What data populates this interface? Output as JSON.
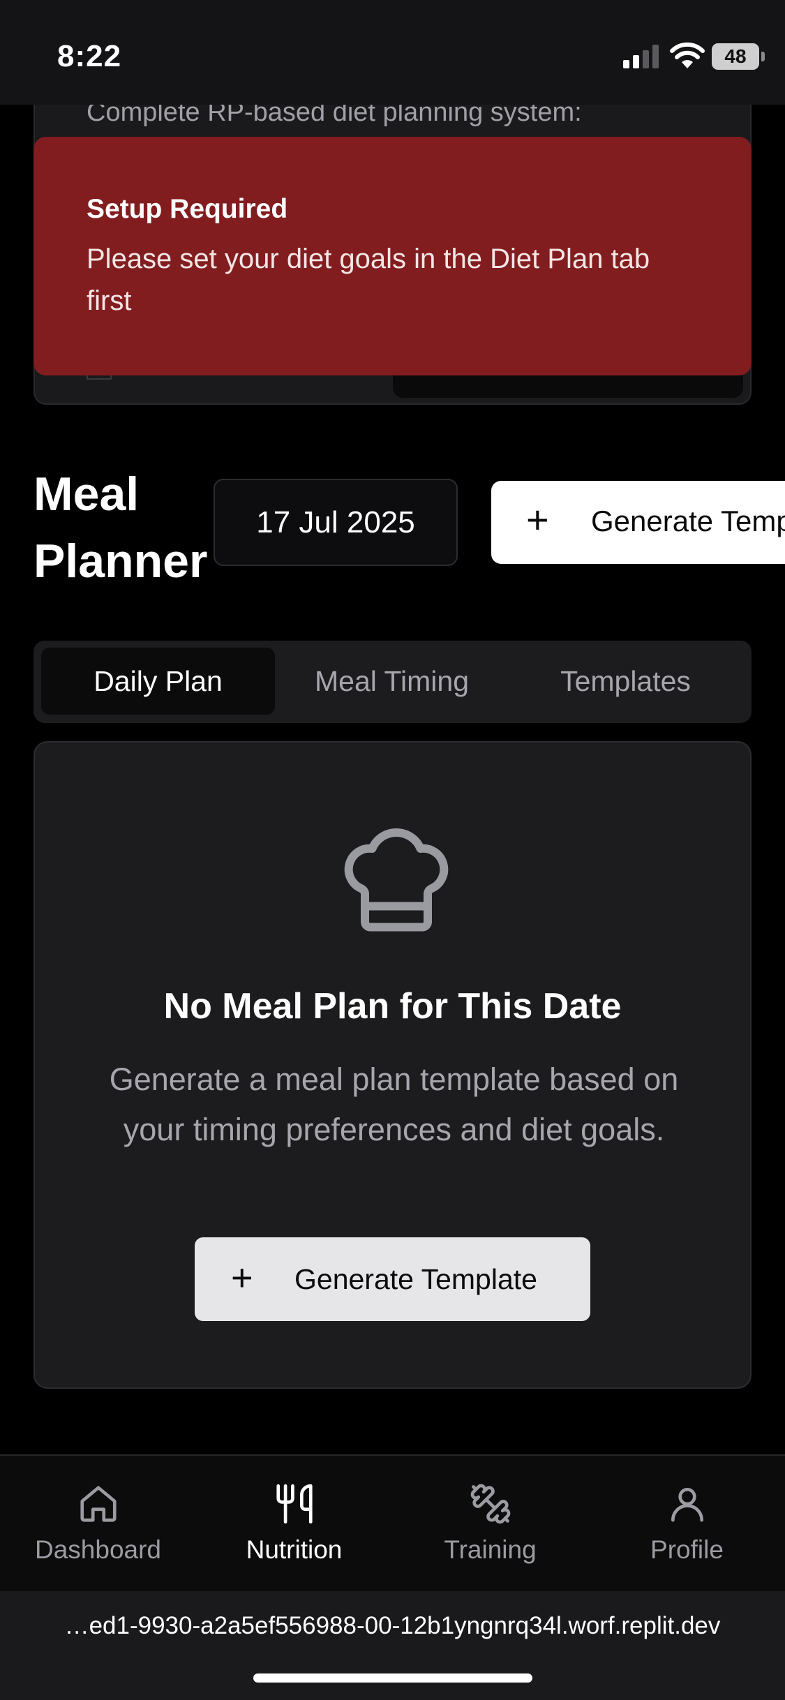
{
  "status_bar": {
    "time": "8:22",
    "battery": "48"
  },
  "background_card": {
    "text": "Complete RP-based diet planning system:"
  },
  "toast": {
    "title": "Setup Required",
    "message": "Please set your diet goals in the Diet Plan tab first"
  },
  "header": {
    "title": "Meal Planner",
    "date": "17 Jul 2025",
    "generate_label": "Generate Template"
  },
  "tabs": [
    {
      "label": "Daily Plan",
      "active": true
    },
    {
      "label": "Meal Timing",
      "active": false
    },
    {
      "label": "Templates",
      "active": false
    }
  ],
  "empty_state": {
    "icon": "chef-hat-icon",
    "title": "No Meal Plan for This Date",
    "description": "Generate a meal plan template based on your timing preferences and diet goals.",
    "button_label": "Generate Template"
  },
  "bottom_nav": [
    {
      "label": "Dashboard",
      "icon": "home-icon",
      "active": false
    },
    {
      "label": "Nutrition",
      "icon": "utensils-icon",
      "active": true
    },
    {
      "label": "Training",
      "icon": "dumbbell-icon",
      "active": false
    },
    {
      "label": "Profile",
      "icon": "user-icon",
      "active": false
    }
  ],
  "browser": {
    "url": "…ed1-9930-a2a5ef556988-00-12b1yngnrq34l.worf.replit.dev"
  },
  "colors": {
    "toast_background": "#821d1f",
    "card_background": "#1c1c1e",
    "primary_button": "#ffffff",
    "secondary_button": "#e6e6e9"
  }
}
